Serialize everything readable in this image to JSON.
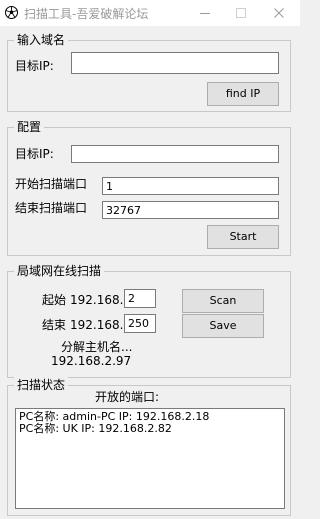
{
  "window": {
    "title": "扫描工具-吾爱破解论坛"
  },
  "find_ip": {
    "legend": "输入域名",
    "target_label": "目标IP:",
    "target_value": "",
    "button_label": "find IP"
  },
  "config": {
    "legend": "配置",
    "target_label": "目标IP:",
    "target_value": "",
    "start_port_label": "开始扫描端口",
    "start_port_value": "1",
    "end_port_label": "结束扫描端口",
    "end_port_value": "32767",
    "start_button_label": "Start"
  },
  "lan_scan": {
    "legend": "局域网在线扫描",
    "start_label": "起始",
    "start_prefix": "192.168.2.",
    "start_value": "2",
    "end_label": "结束",
    "end_prefix": "192.168.2.",
    "end_value": "250",
    "scan_button_label": "Scan",
    "save_button_label": "Save",
    "resolving_text": "分解主机名...",
    "current_ip": "192.168.2.97"
  },
  "status": {
    "legend": "扫描状态",
    "open_ports_label": "开放的端口:",
    "results": [
      "PC名称:   admin-PC IP:   192.168.2.18",
      "PC名称:   UK IP:   192.168.2.82"
    ]
  }
}
